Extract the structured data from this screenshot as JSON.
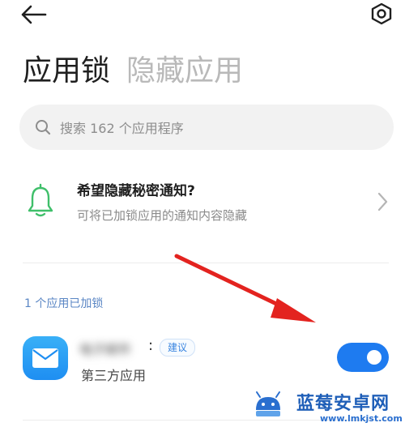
{
  "header": {
    "back_icon": "arrow-left-icon",
    "settings_icon": "gear-icon"
  },
  "tabs": [
    {
      "label": "应用锁",
      "active": true
    },
    {
      "label": "隐藏应用",
      "active": false
    }
  ],
  "search": {
    "placeholder": "搜索 162 个应用程序",
    "icon": "search-icon"
  },
  "notice": {
    "icon": "bell-icon",
    "title": "希望隐藏秘密通知?",
    "subtitle": "可将已加锁应用的通知内容隐藏"
  },
  "locked_section": {
    "label": "1 个应用已加锁",
    "apps": [
      {
        "name": "电子邮件",
        "name_suffix": ":",
        "badge": "建议",
        "type": "第三方应用",
        "locked": true
      }
    ]
  },
  "watermark": {
    "title": "蓝莓安卓网",
    "url": "www.lmkjst.com"
  },
  "colors": {
    "accent": "#1e7bf0",
    "section_label": "#5a86c4",
    "annotation_arrow": "#e3231f"
  }
}
